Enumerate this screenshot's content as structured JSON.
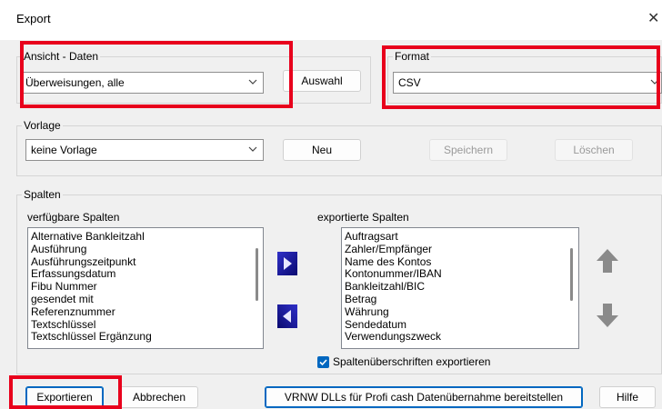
{
  "window": {
    "title": "Export",
    "close_glyph": "✕"
  },
  "ansicht": {
    "legend": "Ansicht - Daten",
    "selected": "Überweisungen, alle",
    "button": "Auswahl"
  },
  "format": {
    "legend": "Format",
    "selected": "CSV"
  },
  "vorlage": {
    "legend": "Vorlage",
    "selected": "keine Vorlage",
    "new_button": "Neu",
    "save_button": "Speichern",
    "delete_button": "Löschen"
  },
  "spalten": {
    "legend": "Spalten",
    "available_label": "verfügbare Spalten",
    "available": [
      "Alternative Bankleitzahl",
      "Ausführung",
      "Ausführungszeitpunkt",
      "Erfassungsdatum",
      "Fibu Nummer",
      "gesendet mit",
      "Referenznummer",
      "Textschlüssel",
      "Textschlüssel Ergänzung"
    ],
    "exported_label": "exportierte Spalten",
    "exported": [
      "Auftragsart",
      "Zahler/Empfänger",
      "Name des Kontos",
      "Kontonummer/IBAN",
      "Bankleitzahl/BIC",
      "Betrag",
      "Währung",
      "Sendedatum",
      "Verwendungszweck"
    ],
    "headers_checkbox": {
      "label": "Spaltenüberschriften exportieren",
      "checked": true
    }
  },
  "footer": {
    "export_button": "Exportieren",
    "cancel_button": "Abbrechen",
    "vrnw_button": "VRNW DLLs für Profi cash Datenübernahme bereitstellen",
    "help_button": "Hilfe"
  },
  "colors": {
    "highlight": "#e8001c",
    "accent": "#0067c0",
    "move_arrow": "#1a1aa6",
    "updown_arrow": "#8a8a8a"
  }
}
